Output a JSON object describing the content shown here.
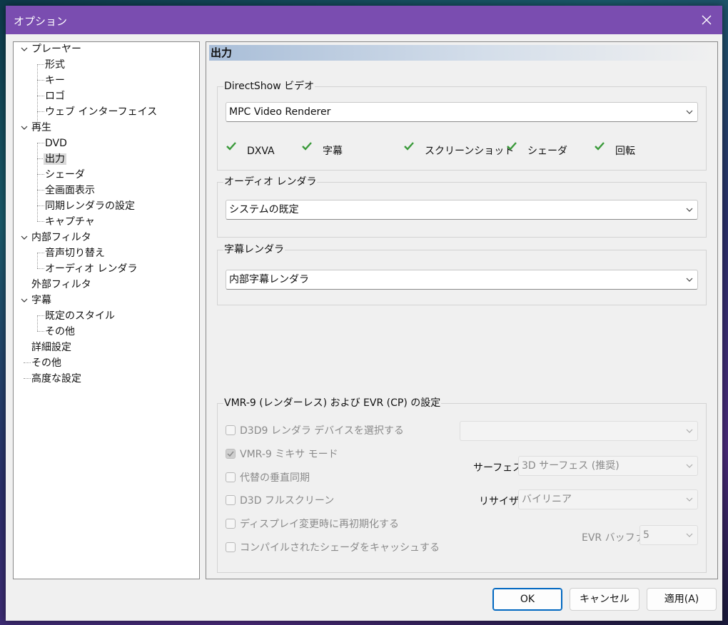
{
  "window": {
    "title": "オプション"
  },
  "tree": [
    {
      "label": "プレーヤー",
      "expanded": true
    },
    {
      "label": "形式"
    },
    {
      "label": "キー"
    },
    {
      "label": "ロゴ"
    },
    {
      "label": "ウェブ インターフェイス"
    },
    {
      "label": "再生",
      "expanded": true
    },
    {
      "label": "DVD"
    },
    {
      "label": "出力",
      "selected": true
    },
    {
      "label": "シェーダ"
    },
    {
      "label": "全画面表示"
    },
    {
      "label": "同期レンダラの設定"
    },
    {
      "label": "キャプチャ"
    },
    {
      "label": "内部フィルタ",
      "expanded": true
    },
    {
      "label": "音声切り替え"
    },
    {
      "label": "オーディオ レンダラ"
    },
    {
      "label": "外部フィルタ"
    },
    {
      "label": "字幕",
      "expanded": true
    },
    {
      "label": "既定のスタイル"
    },
    {
      "label": "その他"
    },
    {
      "label": "詳細設定"
    },
    {
      "label": "その他"
    },
    {
      "label": "高度な設定"
    }
  ],
  "panel": {
    "header": "出力",
    "directshow": {
      "legend": "DirectShow ビデオ",
      "selected": "MPC Video Renderer",
      "features": [
        "DXVA",
        "字幕",
        "スクリーンショット",
        "シェーダ",
        "回転"
      ]
    },
    "audio": {
      "legend": "オーディオ レンダラ",
      "selected": "システムの既定"
    },
    "subtitle": {
      "legend": "字幕レンダラ",
      "selected": "内部字幕レンダラ"
    },
    "vmr": {
      "legend": "VMR-9 (レンダーレス) および EVR (CP) の設定",
      "options": [
        {
          "label": "D3D9 レンダラ デバイスを選択する",
          "checked": false
        },
        {
          "label": "VMR-9 ミキサ モード",
          "checked": true
        },
        {
          "label": "代替の垂直同期",
          "checked": false
        },
        {
          "label": "D3D フルスクリーン",
          "checked": false
        },
        {
          "label": "ディスプレイ変更時に再初期化する",
          "checked": false
        },
        {
          "label": "コンパイルされたシェーダをキャッシュする",
          "checked": false
        }
      ],
      "device_value": "",
      "surface_label": "サーフェス:",
      "surface_value": "3D サーフェス (推奨)",
      "resizer_label": "リサイザ:",
      "resizer_value": "バイリニア",
      "evr_label": "EVR バッファ:",
      "evr_value": "5"
    }
  },
  "buttons": {
    "ok": "OK",
    "cancel": "キャンセル",
    "apply": "適用(A)"
  },
  "colors": {
    "titlebar": "#7a4db0",
    "check": "#3a9a3a",
    "accent": "#0067c0"
  }
}
